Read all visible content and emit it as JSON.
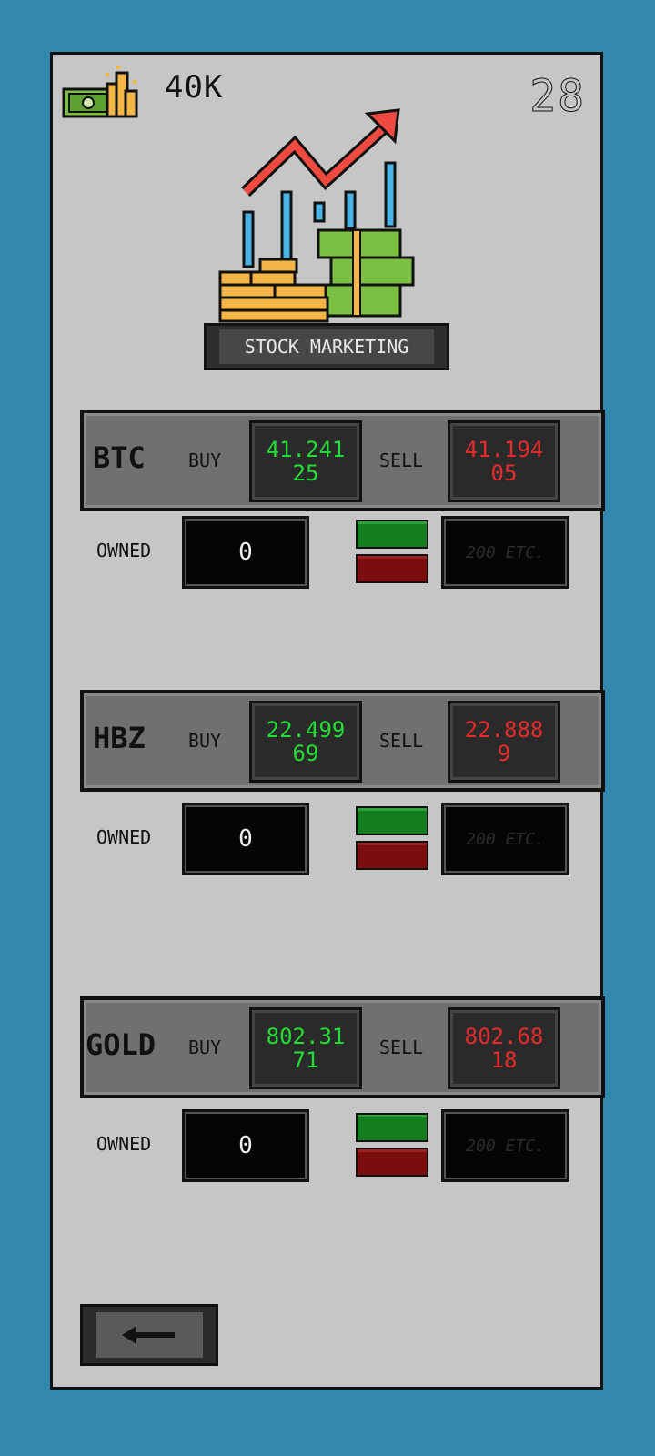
{
  "header": {
    "money": "40K",
    "day": "28"
  },
  "title": "STOCK MARKETING",
  "labels": {
    "buy": "BUY",
    "sell": "SELL",
    "owned": "OWNED",
    "qty_placeholder": "200 ETC."
  },
  "stocks": [
    {
      "symbol": "BTC",
      "buy_line1": "41.241",
      "buy_line2": "25",
      "sell_line1": "41.194",
      "sell_line2": "05",
      "owned": "0"
    },
    {
      "symbol": "HBZ",
      "buy_line1": "22.499",
      "buy_line2": "69",
      "sell_line1": "22.888",
      "sell_line2": "9",
      "owned": "0"
    },
    {
      "symbol": "GOLD",
      "buy_line1": "802.31",
      "buy_line2": "71",
      "sell_line1": "802.68",
      "sell_line2": "18",
      "owned": "0"
    }
  ],
  "colors": {
    "background": "#3389ad",
    "panel": "#c6c6c6",
    "buy_price": "#22dd33",
    "sell_price": "#e82a2a",
    "buy_button": "#137d1f",
    "sell_button": "#7a0e0e"
  },
  "icons": [
    "money-stack-icon",
    "stock-growth-logo-icon",
    "back-arrow-icon"
  ]
}
